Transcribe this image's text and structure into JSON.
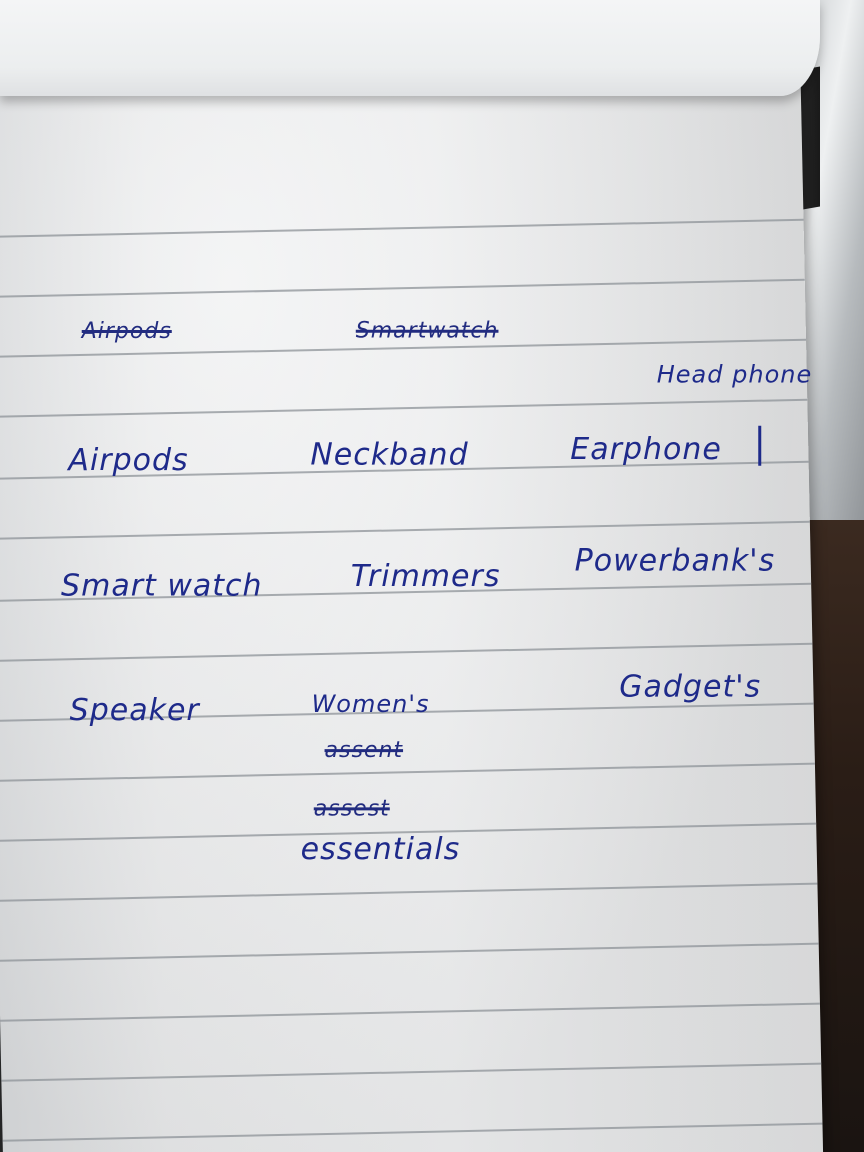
{
  "notes": {
    "row_1_struck": [
      "Airpods",
      "Smartwatch"
    ],
    "annotation": "Head phone",
    "row_2": [
      "Airpods",
      "Neckband",
      "Earphone"
    ],
    "row_3": [
      "Smart watch",
      "Trimmers",
      "Powerbank's"
    ],
    "row_4": [
      "Speaker",
      "Women's",
      "Gadget's"
    ],
    "struck_below": [
      "assent",
      "assest"
    ],
    "last_word": "essentials"
  },
  "colors": {
    "ink": "#1e2a8a",
    "paper": "#f2f3f4",
    "rule": "#8e9398"
  }
}
